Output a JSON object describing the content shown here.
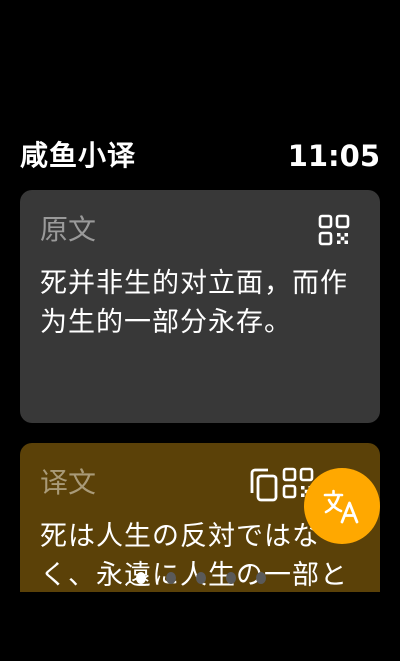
{
  "header": {
    "app_title": "咸鱼小译",
    "time": "11:05"
  },
  "source_card": {
    "label": "原文",
    "text": "死并非生的对立面，而作为生的一部分永存。",
    "qr_icon": "qr-code-icon"
  },
  "target_card": {
    "label": "译文",
    "text": "死は人生の反対ではなく、永遠に人生の一部として",
    "copy_icon": "copy-icon",
    "qr_icon": "qr-code-icon"
  },
  "fab": {
    "icon": "translate-icon"
  },
  "pager": {
    "count": 5,
    "active_index": 0
  },
  "colors": {
    "background": "#000000",
    "source_card": "#383838",
    "target_card": "#5b4108",
    "accent": "#ffa800",
    "label_gray": "#9a9a9a"
  }
}
